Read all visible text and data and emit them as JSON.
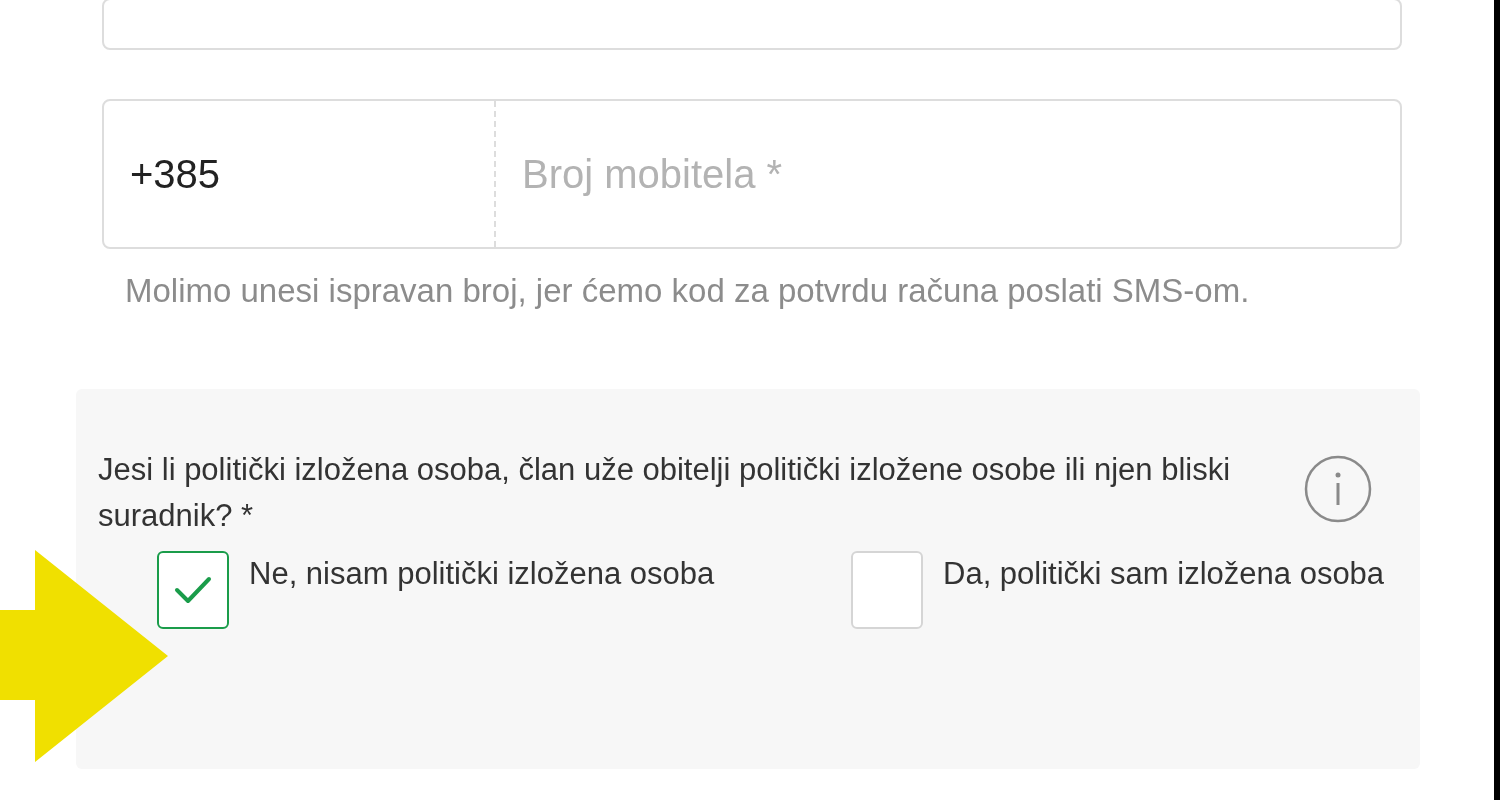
{
  "phone": {
    "prefix": "+385",
    "placeholder": "Broj mobitela *",
    "hint": "Molimo unesi ispravan broj, jer ćemo kod za potvrdu računa poslati SMS-om."
  },
  "pep": {
    "question": "Jesi li politički izložena osoba, član uže obitelji politički izložene osobe ili njen bliski suradnik? *",
    "options": [
      {
        "label": "Ne, nisam politički izložena osoba",
        "checked": true
      },
      {
        "label": "Da, politički sam izložena osoba",
        "checked": false
      }
    ]
  }
}
